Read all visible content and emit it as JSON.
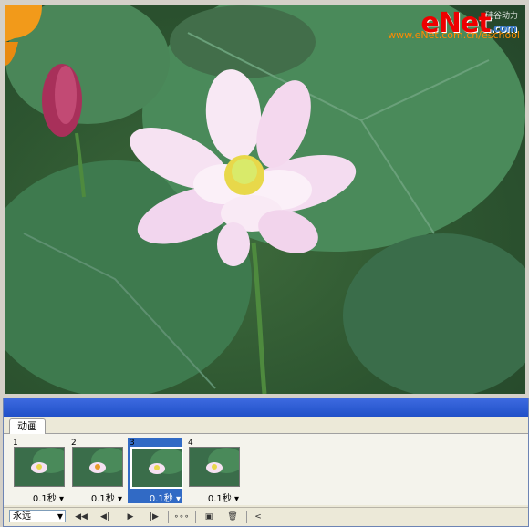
{
  "watermark": {
    "logo_e": "e",
    "logo_net": "Net",
    "logo_suffix": ".com",
    "cn_text": "硅谷动力",
    "url": "www.eNet.com.cn/eschool"
  },
  "panel": {
    "tab_label": "动画",
    "frames": [
      {
        "number": "1",
        "delay": "0.1秒 ▾",
        "selected": false
      },
      {
        "number": "2",
        "delay": "0.1秒 ▾",
        "selected": false
      },
      {
        "number": "3",
        "delay": "0.1秒 ▾",
        "selected": true
      },
      {
        "number": "4",
        "delay": "0.1秒 ▾",
        "selected": false
      }
    ],
    "loop_value": "永远",
    "controls": {
      "first": "◀◀",
      "prev": "◀|",
      "play": "▶",
      "next": "|▶",
      "tween": "∘∘∘",
      "new_frame": "▣",
      "delete": "🗑",
      "scroll": "<"
    }
  },
  "colors": {
    "panel_title": "#2050c8",
    "selected_frame": "#316ac5",
    "watermark_red": "#e00000",
    "watermark_orange": "#ff8a00"
  }
}
